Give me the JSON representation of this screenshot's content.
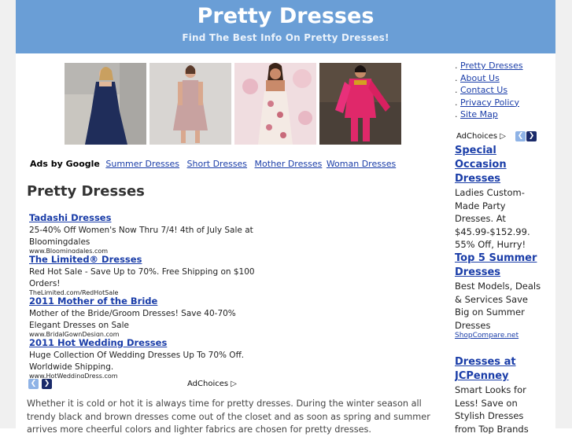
{
  "header": {
    "title": "Pretty Dresses",
    "tagline": "Find The Best Info On Pretty Dresses!"
  },
  "colors": {
    "header_bg": "#6a9ed6",
    "link": "#1a3da8",
    "ad_nav_light": "#8fb3e6",
    "ad_nav_dark": "#1a2a6a"
  },
  "gallery": [
    {
      "name": "navy-dress-photo"
    },
    {
      "name": "blush-dress-photo"
    },
    {
      "name": "floral-dress-photo"
    },
    {
      "name": "pink-salwar-photo"
    }
  ],
  "ads_bar": {
    "label": "Ads by Google",
    "links": [
      "Summer Dresses",
      "Short Dresses",
      "Mother Dresses",
      "Woman Dresses"
    ]
  },
  "page_title": "Pretty Dresses",
  "ads": [
    {
      "title": "Tadashi Dresses",
      "desc": "25-40% Off Women's Now Thru 7/4! 4th of July Sale at Bloomingdales",
      "url": "www.Bloomingdales.com"
    },
    {
      "title": "The Limited® Dresses",
      "desc": "Red Hot Sale - Save Up to 70%. Free Shipping on $100 Orders!",
      "url": "TheLimited.com/RedHotSale"
    },
    {
      "title": "2011 Mother of the Bride",
      "desc": "Mother of the Bride/Groom Dresses! Save 40-70% Elegant Dresses on Sale",
      "url": "www.BridalGownDesign.com"
    },
    {
      "title": "2011 Hot Wedding Dresses",
      "desc": "Huge Collection Of Wedding Dresses Up To 70% Off. Worldwide Shipping.",
      "url": "www.HotWeddingDress.com"
    }
  ],
  "adchoices": "AdChoices",
  "paragraph": "Whether it is cold or hot it is always time for pretty dresses. During the winter season all trendy black and brown dresses come out of the closet and as soon as spring and summer arrives more cheerful colors and lighter fabrics are chosen for pretty dresses.",
  "nav": {
    "bullet": ".",
    "items": [
      "Pretty Dresses",
      "About Us",
      "Contact Us",
      "Privacy Policy",
      "Site Map"
    ]
  },
  "side_ads": [
    {
      "title": "Special Occasion Dresses",
      "desc": "Ladies Custom-Made Party Dresses. At $45.99-$152.99. 55% Off, Hurry!",
      "url": ""
    },
    {
      "title": "Top 5 Summer Dresses",
      "desc": "Best Models, Deals & Services Save Big on Summer Dresses",
      "url": "ShopCompare.net"
    },
    {
      "title": "Dresses at JCPenney",
      "desc": "Smart Looks for Less! Save on Stylish Dresses from Top Brands",
      "url": ""
    }
  ]
}
